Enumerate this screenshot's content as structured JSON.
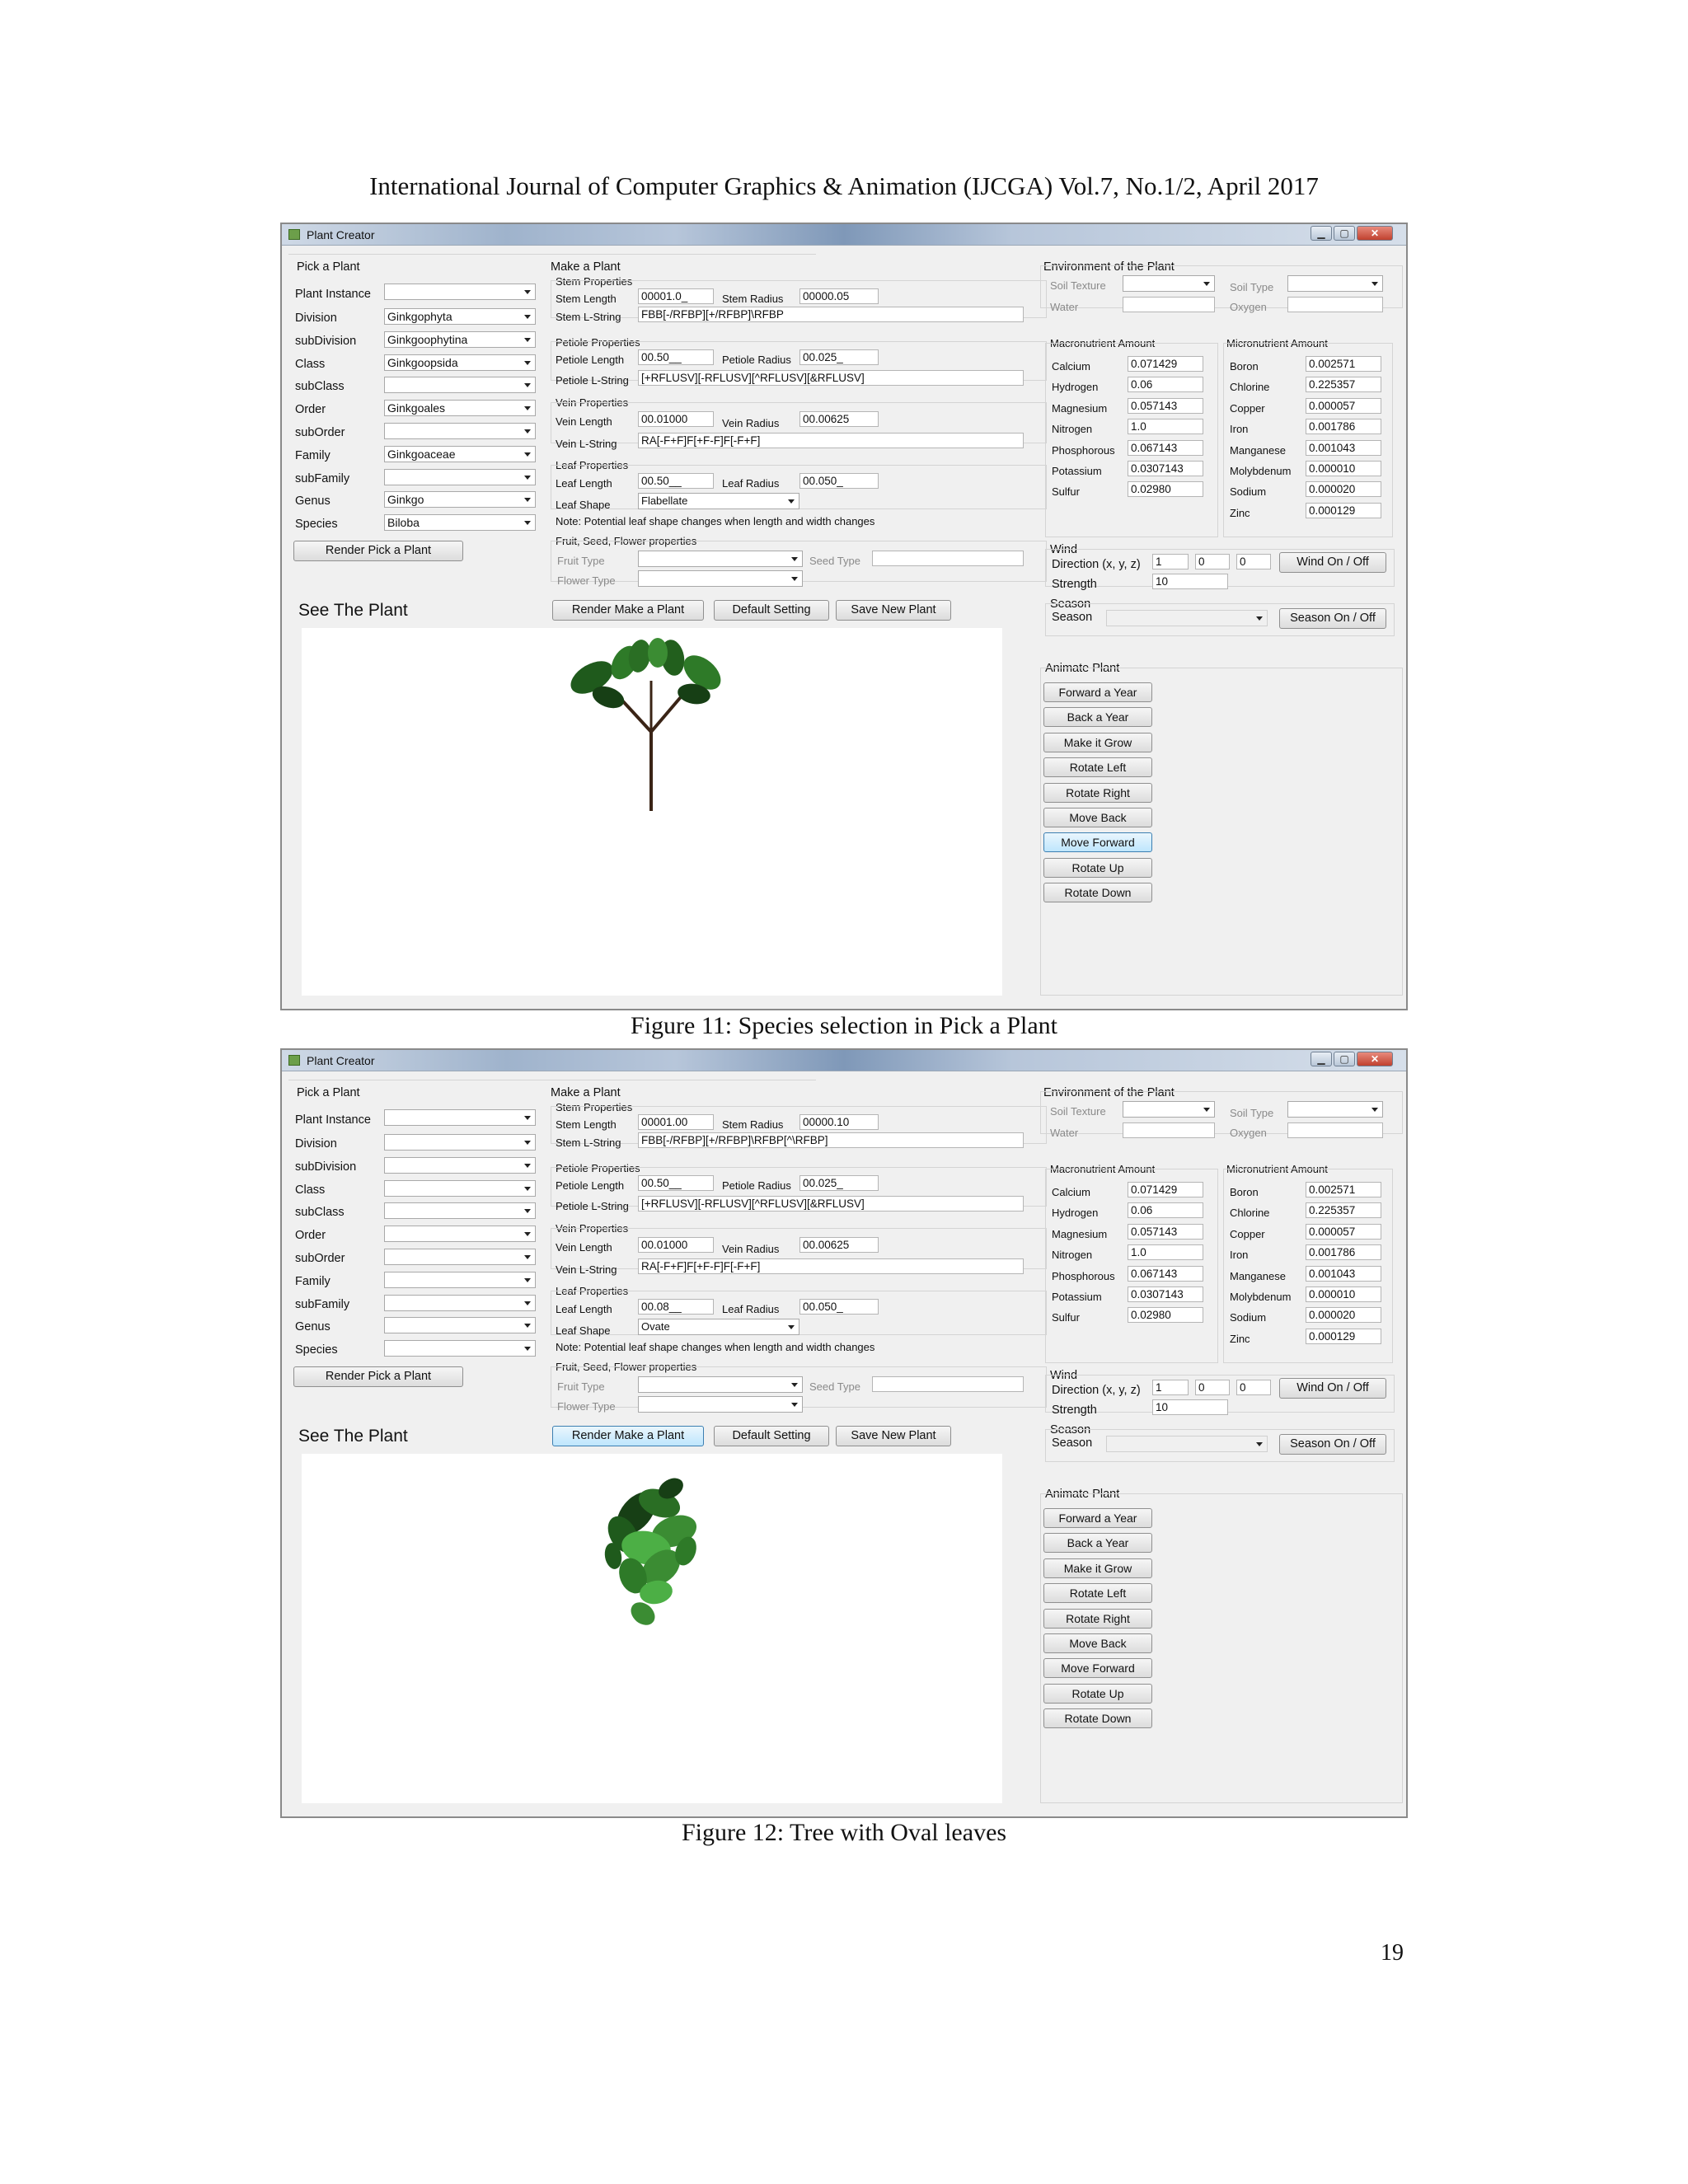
{
  "header": {
    "text": "International Journal of Computer Graphics & Animation (IJCGA) Vol.7, No.1/2, April 2017"
  },
  "page_number": "19",
  "labels": {
    "app_title": "Plant Creator",
    "pick_group": "Pick a Plant",
    "plant_instance": "Plant Instance",
    "division": "Division",
    "subdivision": "subDivision",
    "class": "Class",
    "subclass": "subClass",
    "order": "Order",
    "suborder": "subOrder",
    "family": "Family",
    "subfamily": "subFamily",
    "genus": "Genus",
    "species": "Species",
    "render_pick": "Render Pick a Plant",
    "see_plant": "See The Plant",
    "make_group": "Make a Plant",
    "stem_props": "Stem Properties",
    "stem_length": "Stem Length",
    "stem_radius": "Stem Radius",
    "stem_lstring": "Stem L-String",
    "petiole_props": "Petiole Properties",
    "petiole_length": "Petiole Length",
    "petiole_radius": "Petiole Radius",
    "petiole_lstring": "Petiole L-String",
    "vein_props": "Vein Properties",
    "vein_length": "Vein Length",
    "vein_radius": "Vein Radius",
    "vein_lstring": "Vein L-String",
    "leaf_props": "Leaf Properties",
    "leaf_length": "Leaf Length",
    "leaf_radius": "Leaf Radius",
    "leaf_shape": "Leaf Shape",
    "note": "Note: Potential leaf shape changes when length and width changes",
    "fruit_group": "Fruit, Seed, Flower properties",
    "fruit_type": "Fruit Type",
    "seed_type": "Seed Type",
    "flower_type": "Flower Type",
    "render_make": "Render Make a Plant",
    "default_setting": "Default Setting",
    "save_new": "Save New Plant",
    "env_group": "Environment of the Plant",
    "soil_texture": "Soil Texture",
    "soil_type": "Soil Type",
    "water": "Water",
    "oxygen": "Oxygen",
    "macro": "Macronutrient Amount",
    "micro": "Micronutrient Amount",
    "wind": "Wind",
    "direction": "Direction (x, y, z)",
    "strength": "Strength",
    "wind_toggle": "Wind On / Off",
    "season_group": "Season",
    "season": "Season",
    "season_toggle": "Season On / Off",
    "animate_group": "Animate Plant"
  },
  "macronutrients": [
    {
      "name": "Calcium",
      "value": "0.071429"
    },
    {
      "name": "Hydrogen",
      "value": "0.06"
    },
    {
      "name": "Magnesium",
      "value": "0.057143"
    },
    {
      "name": "Nitrogen",
      "value": "1.0"
    },
    {
      "name": "Phosphorous",
      "value": "0.067143"
    },
    {
      "name": "Potassium",
      "value": "0.0307143"
    },
    {
      "name": "Sulfur",
      "value": "0.02980"
    }
  ],
  "micronutrients": [
    {
      "name": "Boron",
      "value": "0.002571"
    },
    {
      "name": "Chlorine",
      "value": "0.225357"
    },
    {
      "name": "Copper",
      "value": "0.000057"
    },
    {
      "name": "Iron",
      "value": "0.001786"
    },
    {
      "name": "Manganese",
      "value": "0.001043"
    },
    {
      "name": "Molybdenum",
      "value": "0.000010"
    },
    {
      "name": "Sodium",
      "value": "0.000020"
    },
    {
      "name": "Zinc",
      "value": "0.000129"
    }
  ],
  "wind": {
    "x": "1",
    "y": "0",
    "z": "0",
    "strength": "10"
  },
  "animate_buttons": [
    "Forward a Year",
    "Back a Year",
    "Make it Grow",
    "Rotate Left",
    "Rotate Right",
    "Move Back",
    "Move Forward",
    "Rotate Up",
    "Rotate Down"
  ],
  "figures": [
    {
      "caption": "Figure 11: Species selection in Pick a Plant",
      "taxonomy": {
        "division": "Ginkgophyta",
        "subdivision": "Ginkgoophytina",
        "class": "Ginkgoopsida",
        "order": "Ginkgoales",
        "family": "Ginkgoaceae",
        "genus": "Ginkgo",
        "species": "Biloba"
      },
      "stem_length": "00001.0_",
      "stem_radius": "00000.05",
      "stem_lstring": "FBB[-/RFBP][+/RFBP]\\RFBP",
      "petiole_length": "00.50__",
      "petiole_radius": "00.025_",
      "petiole_lstring": "[+RFLUSV][-RFLUSV][^RFLUSV][&RFLUSV]",
      "vein_length": "00.01000",
      "vein_radius": "00.00625",
      "vein_lstring": "RA[-F+F]F[+F-F]F[-F+F]",
      "leaf_length": "00.50__",
      "leaf_radius": "00.050_",
      "leaf_shape": "Flabellate"
    },
    {
      "caption": "Figure 12: Tree with Oval leaves",
      "taxonomy": {
        "division": "",
        "subdivision": "",
        "class": "",
        "order": "",
        "family": "",
        "genus": "",
        "species": ""
      },
      "stem_length": "00001.00",
      "stem_radius": "00000.10",
      "stem_lstring": "FBB[-/RFBP][+/RFBP]\\RFBP[^\\RFBP]",
      "petiole_length": "00.50__",
      "petiole_radius": "00.025_",
      "petiole_lstring": "[+RFLUSV][-RFLUSV][^RFLUSV][&RFLUSV]",
      "vein_length": "00.01000",
      "vein_radius": "00.00625",
      "vein_lstring": "RA[-F+F]F[+F-F]F[-F+F]",
      "leaf_length": "00.08__",
      "leaf_radius": "00.050_",
      "leaf_shape": "Ovate"
    }
  ]
}
